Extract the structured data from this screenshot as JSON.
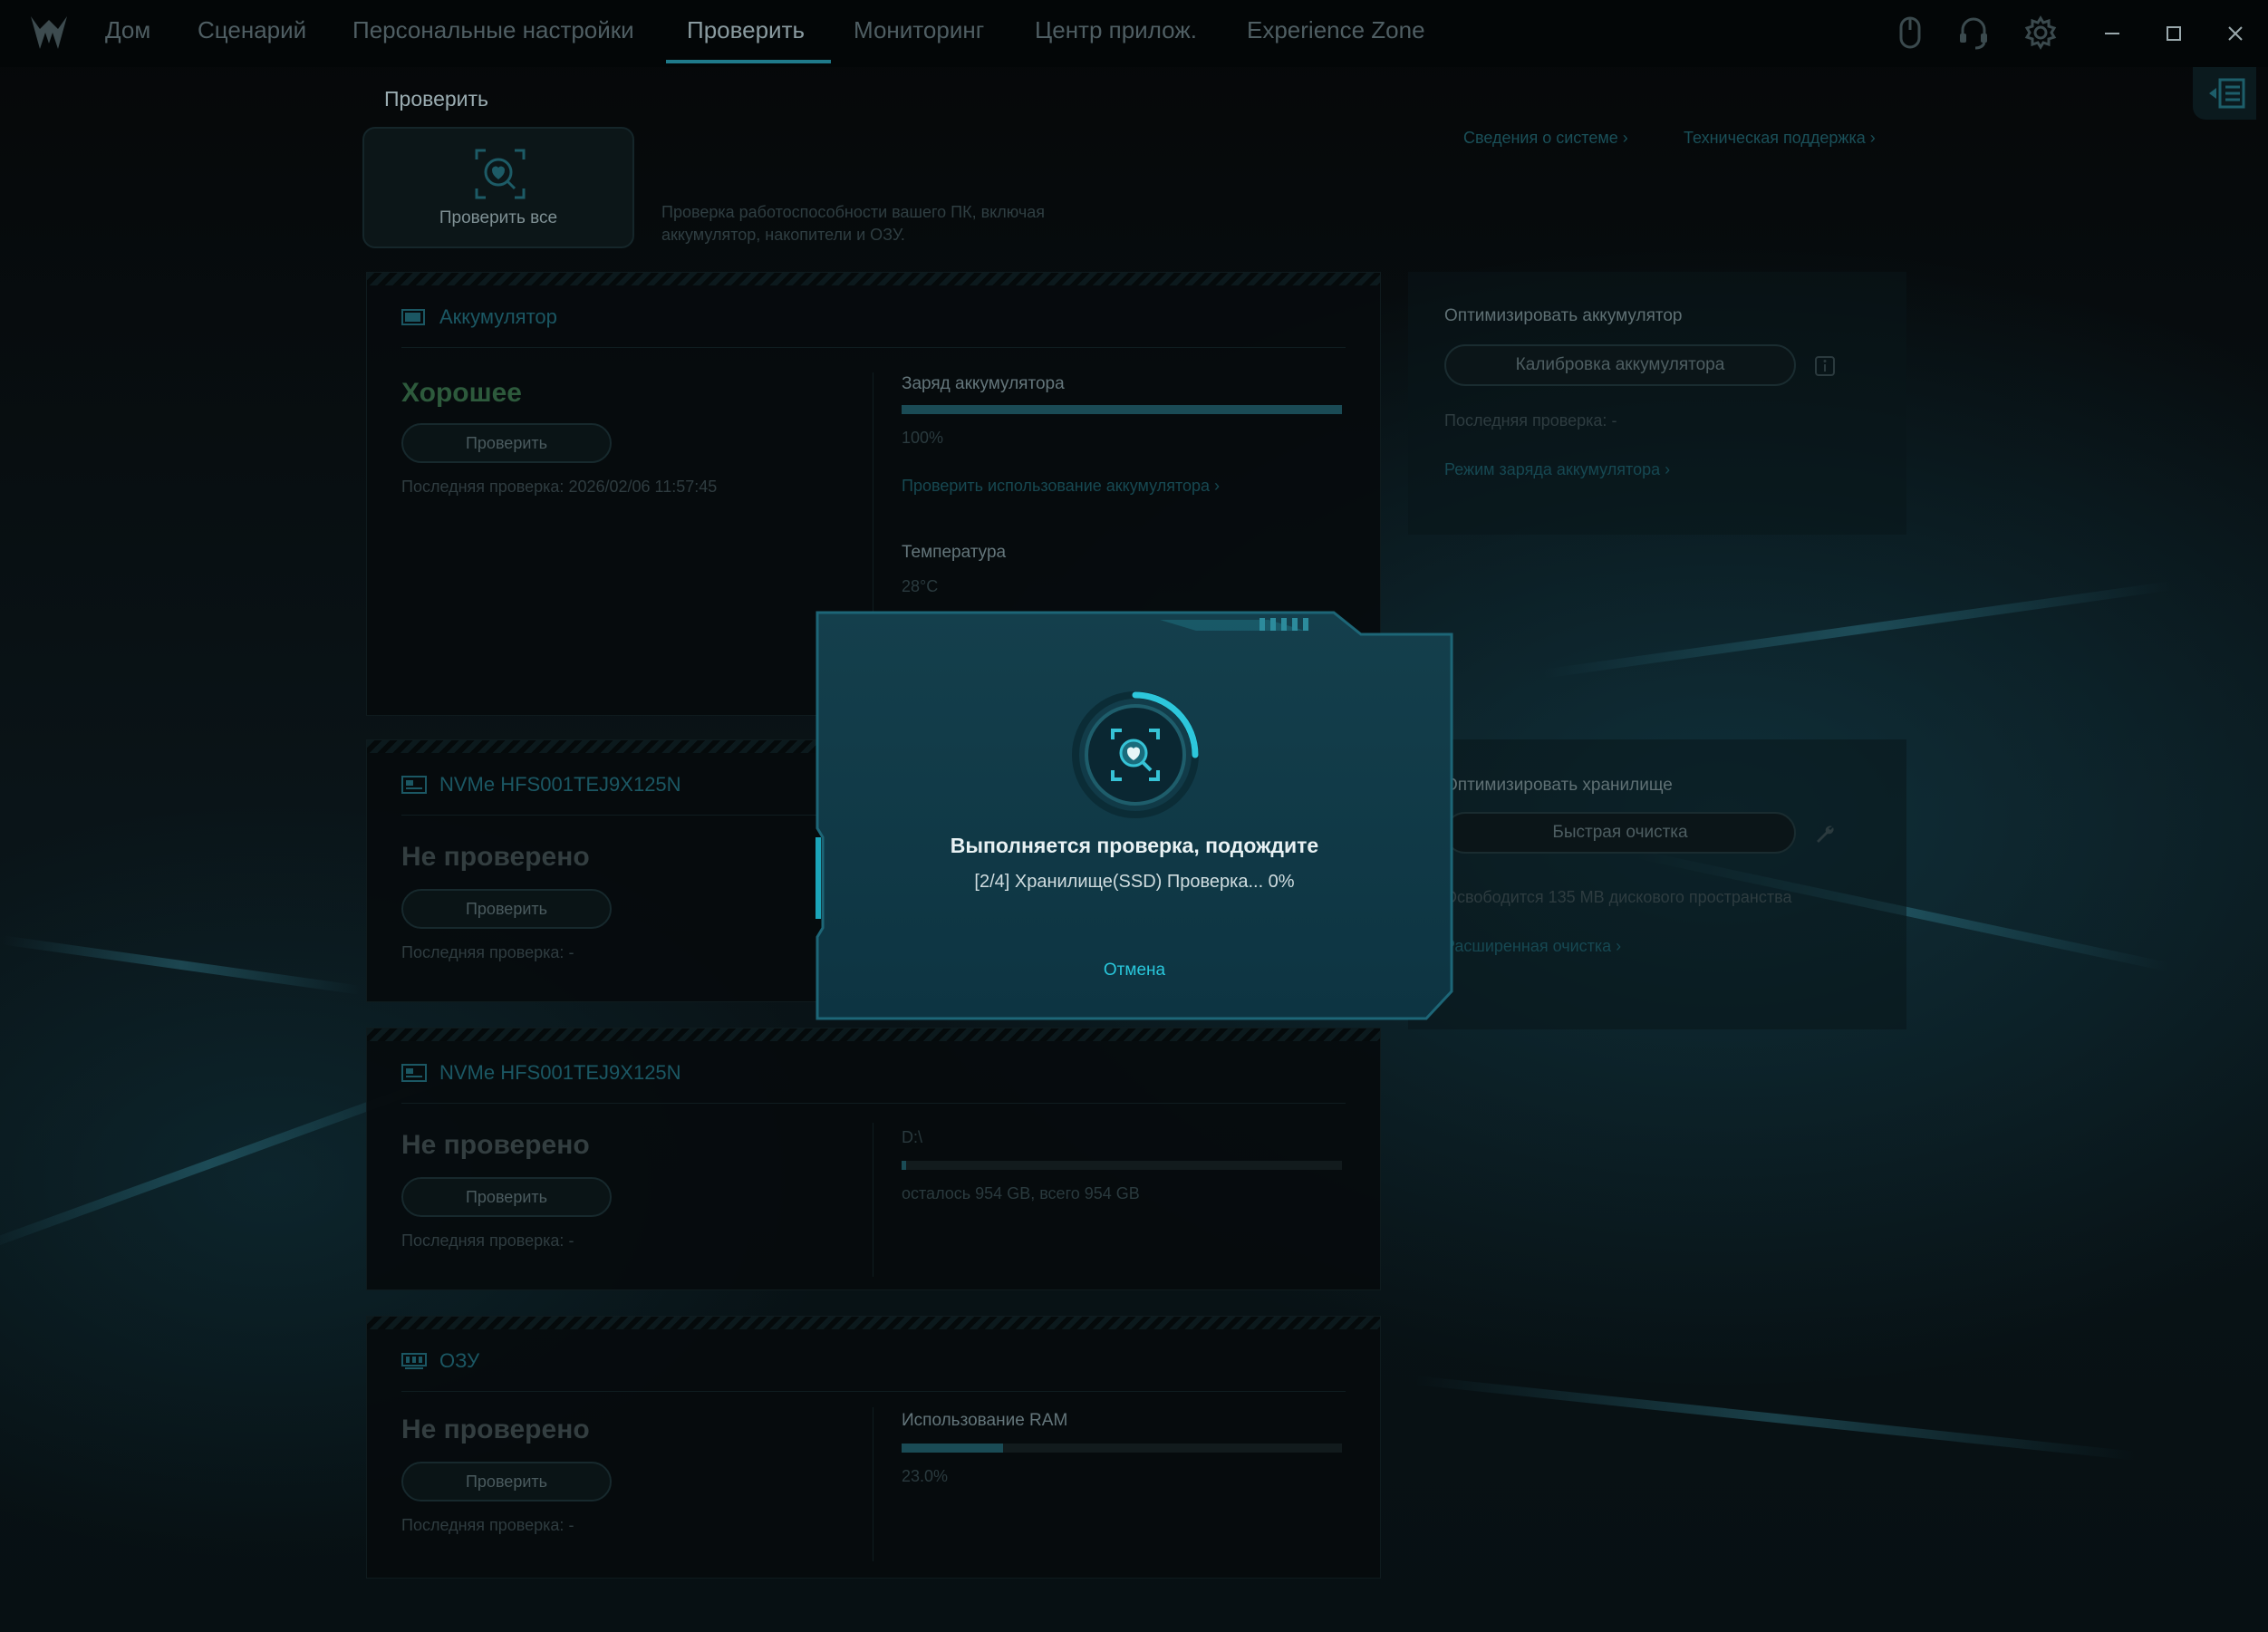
{
  "nav": {
    "tabs": [
      {
        "label": "Дом"
      },
      {
        "label": "Сценарий"
      },
      {
        "label": "Персональные настройки"
      },
      {
        "label": "Проверить"
      },
      {
        "label": "Мониторинг"
      },
      {
        "label": "Центр прилож."
      },
      {
        "label": "Experience Zone"
      }
    ],
    "active_tab": "Проверить"
  },
  "page": {
    "title": "Проверить",
    "check_all_label": "Проверить все",
    "check_all_description": "Проверка работоспособности вашего ПК, включая аккумулятор, накопители и ОЗУ.",
    "links": {
      "system_info": "Сведения о системе ›",
      "tech_support": "Техническая поддержка ›"
    }
  },
  "sections": {
    "battery": {
      "title": "Аккумулятор",
      "status": "Хорошее",
      "check_label": "Проверить",
      "last_check": "Последняя проверка: 2026/02/06 11:57:45",
      "charge_label": "Заряд аккумулятора",
      "charge_value": "100%",
      "charge_fraction": 1.0,
      "usage_link": "Проверить использование аккумулятора ›",
      "temp_label": "Температура",
      "temp_value": "28°C"
    },
    "ssd1": {
      "title": "NVMe HFS001TEJ9X125N",
      "status": "Не проверено",
      "check_label": "Проверить",
      "last_check": "Последняя проверка: -"
    },
    "ssd2": {
      "title": "NVMe HFS001TEJ9X125N",
      "status": "Не проверено",
      "check_label": "Проверить",
      "last_check": "Последняя проверка: -",
      "drive_label": "D:\\",
      "drive_usage": "осталось 954 GB, всего 954 GB",
      "drive_used_fraction": 0.01
    },
    "ram": {
      "title": "ОЗУ",
      "status": "Не проверено",
      "check_label": "Проверить",
      "last_check": "Последняя проверка: -",
      "usage_label": "Использование RAM",
      "usage_value": "23.0%",
      "usage_fraction": 0.23
    }
  },
  "side": {
    "battery_opt": {
      "title": "Оптимизировать аккумулятор",
      "calibrate_label": "Калибровка аккумулятора",
      "last_check": "Последняя проверка: -",
      "charge_mode_link": "Режим заряда аккумулятора ›"
    },
    "storage_opt": {
      "title": "Оптимизировать хранилище",
      "quick_clean_label": "Быстрая очистка",
      "freed_text": "Освободится 135 MB дискового пространства",
      "advanced_link": "Расширенная очистка ›"
    }
  },
  "modal": {
    "title": "Выполняется проверка, подождите",
    "progress_text": "[2/4] Хранилище(SSD) Проверка... 0%",
    "cancel_label": "Отмена",
    "spinner_fraction": 0.25
  },
  "colors": {
    "accent": "#29c7db",
    "background": "#06090b",
    "modal_bg": "#0f3a47"
  }
}
